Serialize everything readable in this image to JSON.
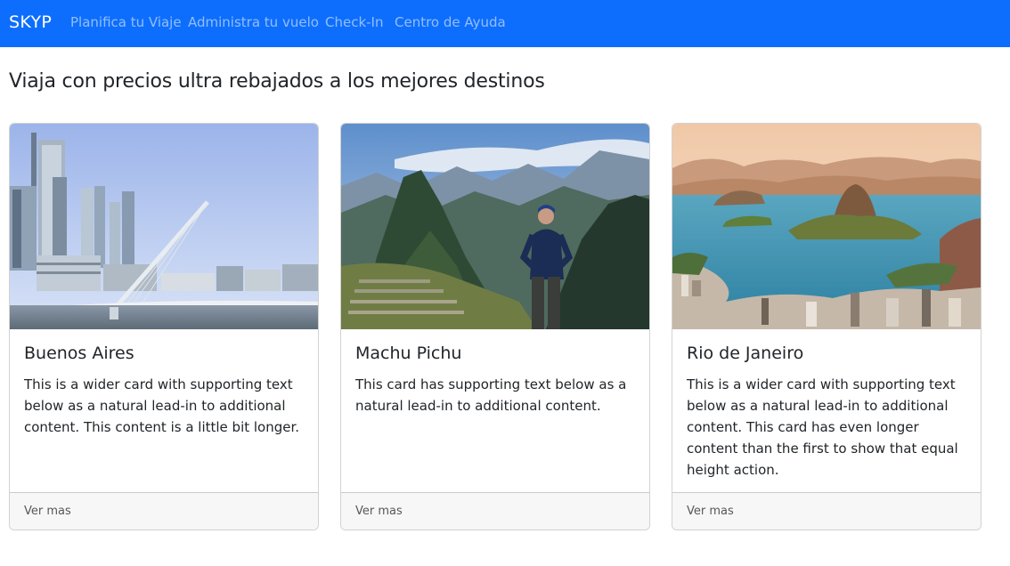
{
  "navbar": {
    "brand": "SKYP",
    "links": [
      "Planifica tu Viaje",
      "Administra tu vuelo",
      "Check-In",
      "Centro de Ayuda"
    ],
    "color": "#0d6efd"
  },
  "main": {
    "heading": "Viaja con precios ultra rebajados a los mejores destinos",
    "cards": [
      {
        "title": "Buenos Aires",
        "text": "This is a wider card with supporting text below as a natural lead-in to additional content. This content is a little bit longer.",
        "footer": "Ver mas",
        "image": "city-skyline-bridge-photo"
      },
      {
        "title": "Machu Pichu",
        "text": "This card has supporting text below as a natural lead-in to additional content.",
        "footer": "Ver mas",
        "image": "mountain-ruins-hiker-photo"
      },
      {
        "title": "Rio de Janeiro",
        "text": "This is a wider card with supporting text below as a natural lead-in to additional content. This card has even longer content than the first to show that equal height action.",
        "footer": "Ver mas",
        "image": "bay-city-sunset-photo"
      }
    ]
  }
}
